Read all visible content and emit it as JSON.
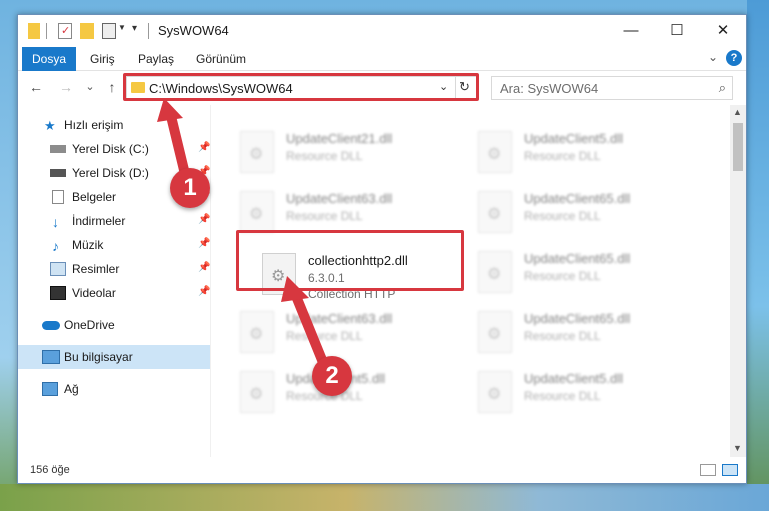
{
  "window": {
    "title": "SysWOW64",
    "minimize_glyph": "—",
    "maximize_glyph": "☐",
    "close_glyph": "✕"
  },
  "ribbon": {
    "tabs": [
      "Dosya",
      "Giriş",
      "Paylaş",
      "Görünüm"
    ],
    "active_tab": "Dosya",
    "help_glyph": "?"
  },
  "nav": {
    "back_glyph": "←",
    "forward_glyph": "→",
    "recent_glyph": "⌄",
    "up_glyph": "↑",
    "address": "C:\\Windows\\SysWOW64",
    "refresh_glyph": "↻",
    "search_placeholder": "Ara: SysWOW64",
    "search_glyph": "⌕"
  },
  "sidebar": {
    "items": [
      {
        "label": "Hızlı erişim",
        "icon": "star-icon",
        "pinned": false
      },
      {
        "label": "Yerel Disk (C:)",
        "icon": "drive-icon",
        "pinned": true
      },
      {
        "label": "Yerel Disk (D:)",
        "icon": "drive-icon",
        "pinned": true
      },
      {
        "label": "Belgeler",
        "icon": "document-icon",
        "pinned": true
      },
      {
        "label": "İndirmeler",
        "icon": "download-icon",
        "pinned": true
      },
      {
        "label": "Müzik",
        "icon": "music-icon",
        "pinned": true
      },
      {
        "label": "Resimler",
        "icon": "picture-icon",
        "pinned": true
      },
      {
        "label": "Videolar",
        "icon": "video-icon",
        "pinned": true
      },
      {
        "label": "OneDrive",
        "icon": "cloud-icon",
        "pinned": false
      },
      {
        "label": "Bu bilgisayar",
        "icon": "computer-icon",
        "pinned": false,
        "selected": true
      },
      {
        "label": "Ağ",
        "icon": "network-icon",
        "pinned": false
      }
    ]
  },
  "files": {
    "highlighted": {
      "name": "collectionhttp2.dll",
      "version": "6.3.0.1",
      "description": "Collection HTTP"
    },
    "blurred": [
      {
        "name": "UpdateClient21.dll",
        "description": "Resource DLL"
      },
      {
        "name": "UpdateClient5.dll",
        "description": "Resource DLL"
      },
      {
        "name": "UpdateClient63.dll",
        "description": "Resource DLL"
      },
      {
        "name": "UpdateClient65.dll",
        "description": "Resource DLL"
      },
      {
        "name": "UpdateClient65.dll",
        "description": "Resource DLL"
      },
      {
        "name": "UpdateClient63.dll",
        "description": "Resource DLL"
      },
      {
        "name": "UpdateClient65.dll",
        "description": "Resource DLL"
      },
      {
        "name": "UpdateClient5.dll",
        "description": "Resource DLL"
      },
      {
        "name": "UpdateClient5.dll",
        "description": "Resource DLL"
      }
    ]
  },
  "status": {
    "item_count": "156 öğe"
  },
  "callouts": {
    "one": "1",
    "two": "2",
    "color": "#d7373f"
  },
  "colors": {
    "accent": "#1979ca",
    "selected_row": "#cce4f7",
    "folder": "#f5c842"
  }
}
